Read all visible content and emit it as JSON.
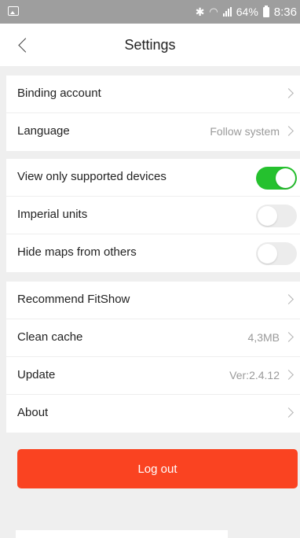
{
  "status_bar": {
    "battery_percent": "64%",
    "time": "8:36",
    "icons": [
      "image-icon",
      "bluetooth-icon",
      "wifi-icon",
      "signal-icon",
      "battery-icon"
    ]
  },
  "nav": {
    "title": "Settings",
    "back_icon": "chevron-left-icon"
  },
  "sections": {
    "account": [
      {
        "label": "Binding account",
        "value": ""
      },
      {
        "label": "Language",
        "value": "Follow system"
      }
    ],
    "toggles": [
      {
        "label": "View only supported devices",
        "on": true
      },
      {
        "label": "Imperial units",
        "on": false
      },
      {
        "label": "Hide maps from others",
        "on": false
      }
    ],
    "misc": [
      {
        "label": "Recommend FitShow",
        "value": ""
      },
      {
        "label": "Clean cache",
        "value": "4,3MB"
      },
      {
        "label": "Update",
        "value": "Ver:2.4.12"
      },
      {
        "label": "About",
        "value": ""
      }
    ]
  },
  "logout_label": "Log out",
  "colors": {
    "accent_red": "#fa4321",
    "toggle_on": "#25c12e",
    "toggle_off": "#ececec",
    "background": "#efefef",
    "status_bar": "#9e9e9e"
  }
}
